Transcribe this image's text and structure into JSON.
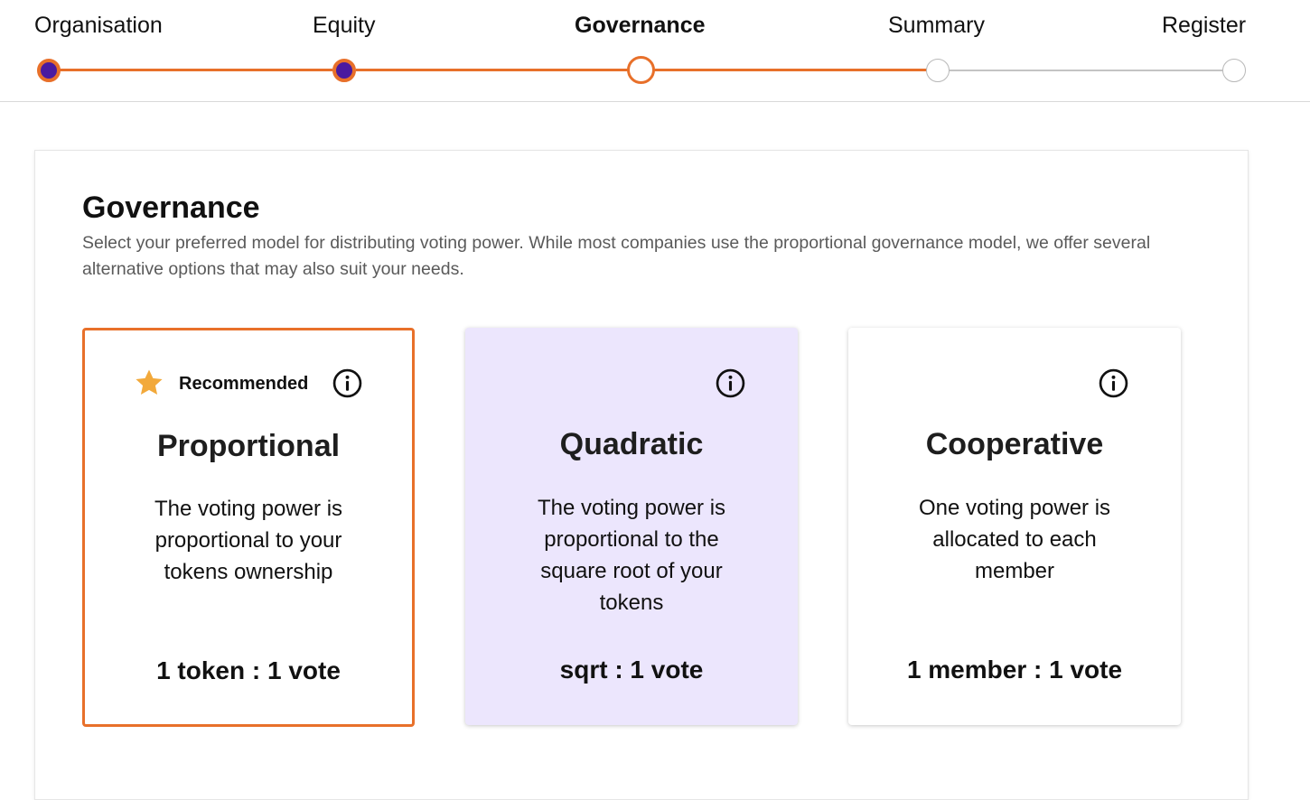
{
  "stepper": {
    "steps": [
      {
        "label": "Organisation",
        "state": "done"
      },
      {
        "label": "Equity",
        "state": "done"
      },
      {
        "label": "Governance",
        "state": "current"
      },
      {
        "label": "Summary",
        "state": "todo"
      },
      {
        "label": "Register",
        "state": "todo"
      }
    ]
  },
  "governance": {
    "title": "Governance",
    "description": "Select your preferred model for distributing voting power. While most companies use the proportional governance model, we offer several alternative options that may also suit your needs.",
    "options": [
      {
        "badge": "Recommended",
        "badge_icon": "star-icon",
        "info_icon": "info-icon",
        "title": "Proportional",
        "description": "The voting power is proportional to your tokens ownership",
        "ratio": "1 token : 1 vote",
        "selected": true
      },
      {
        "info_icon": "info-icon",
        "title": "Quadratic",
        "description": "The voting power is proportional to the square root of your tokens",
        "ratio": "sqrt : 1 vote",
        "selected": false
      },
      {
        "info_icon": "info-icon",
        "title": "Cooperative",
        "description": "One voting power is allocated to each member",
        "ratio": "1 member : 1 vote",
        "selected": false
      }
    ]
  },
  "colors": {
    "accent": "#e8702a",
    "step_done_fill": "#4a1aa0",
    "hover_card": "#ece6fd",
    "star": "#f2a93b"
  }
}
